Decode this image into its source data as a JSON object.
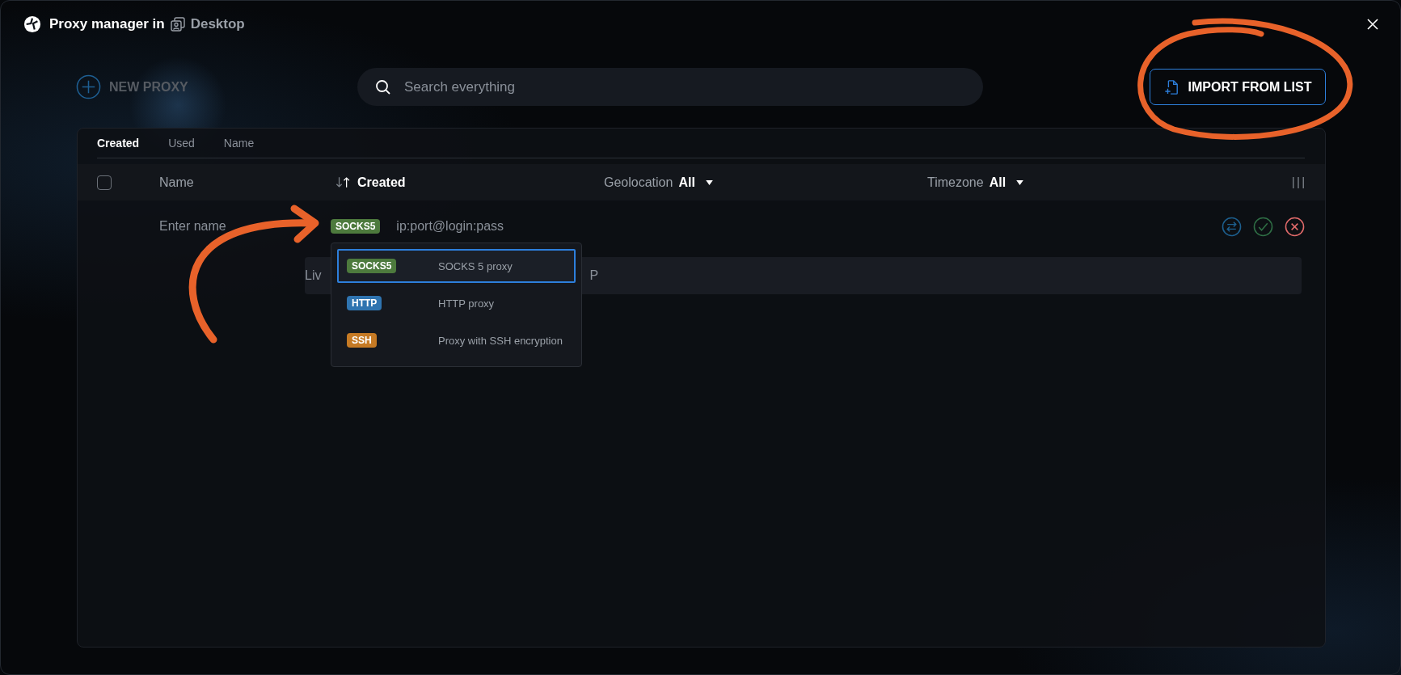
{
  "window": {
    "title": "Proxy manager in",
    "workspace": "Desktop"
  },
  "toolbar": {
    "new_button": "NEW PROXY",
    "search": {
      "placeholder": "Search everything"
    },
    "import_button": "IMPORT FROM LIST"
  },
  "sort_tabs": [
    {
      "label": "Created",
      "selected": true
    },
    {
      "label": "Used",
      "selected": false
    },
    {
      "label": "Name",
      "selected": false
    }
  ],
  "table": {
    "select_all": {
      "checked": false
    },
    "columns": [
      {
        "label": "Name",
        "kind": "plain"
      },
      {
        "label": "Created",
        "kind": "sort"
      },
      {
        "label": "Geolocation",
        "kind": "filter",
        "value": "All"
      },
      {
        "label": "Timezone",
        "kind": "filter",
        "value": "All"
      }
    ]
  },
  "new_row": {
    "name_placeholder": "Enter name",
    "type": {
      "label": "SOCKS5",
      "color": "#4d7a3d"
    },
    "address_placeholder": "ip:port@login:pass",
    "field_start": "Liv",
    "field_end": "P"
  },
  "type_menu": [
    {
      "label": "SOCKS5",
      "description": "SOCKS 5 proxy",
      "color": "#4d7a3d",
      "selected": true
    },
    {
      "label": "HTTP",
      "description": "HTTP proxy",
      "color": "#2f74b0",
      "selected": false
    },
    {
      "label": "SSH",
      "description": "Proxy with SSH encryption",
      "color": "#c67a24",
      "selected": false
    }
  ]
}
